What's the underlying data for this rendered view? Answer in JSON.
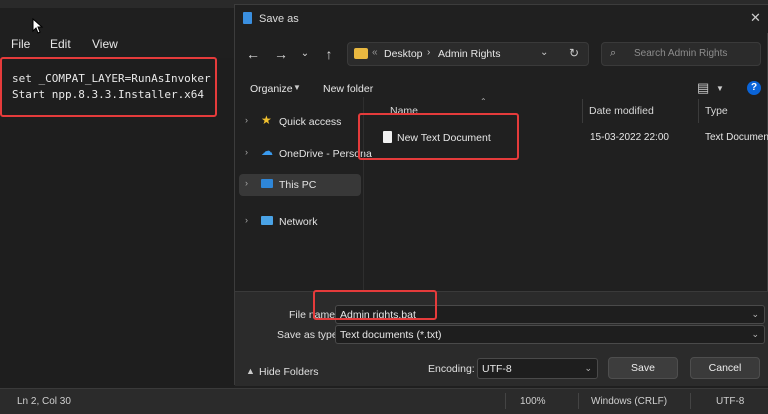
{
  "notepad": {
    "menu": [
      "File",
      "Edit",
      "View"
    ],
    "code_lines": [
      "set _COMPAT_LAYER=RunAsInvoker",
      "Start npp.8.3.3.Installer.x64"
    ],
    "status": {
      "position": "Ln 2, Col 30",
      "zoom": "100%",
      "line_endings": "Windows (CRLF)",
      "encoding": "UTF-8"
    }
  },
  "dialog": {
    "title": "Save as",
    "breadcrumb": [
      "Desktop",
      "Admin Rights"
    ],
    "search_placeholder": "Search Admin Rights",
    "toolbar": {
      "organize": "Organize",
      "new_folder": "New folder"
    },
    "sidebar": [
      {
        "label": "Quick access",
        "icon": "star-icon"
      },
      {
        "label": "OneDrive - Persona",
        "icon": "cloud-icon"
      },
      {
        "label": "This PC",
        "icon": "pc-icon"
      },
      {
        "label": "Network",
        "icon": "network-icon"
      }
    ],
    "columns": {
      "name": "Name",
      "date": "Date modified",
      "type": "Type"
    },
    "files": [
      {
        "name": "New Text Document",
        "date": "15-03-2022 22:00",
        "type": "Text Document"
      }
    ],
    "file_name_label": "File name:",
    "file_name_value": "Admin rights.bat",
    "save_type_label": "Save as type:",
    "save_type_value": "Text documents (*.txt)",
    "hide_folders": "Hide Folders",
    "encoding_label": "Encoding:",
    "encoding_value": "UTF-8",
    "save_button": "Save",
    "cancel_button": "Cancel"
  },
  "colors": {
    "accent": "#0a64d8",
    "highlight": "#e53b3b",
    "folder": "#e9b840"
  }
}
